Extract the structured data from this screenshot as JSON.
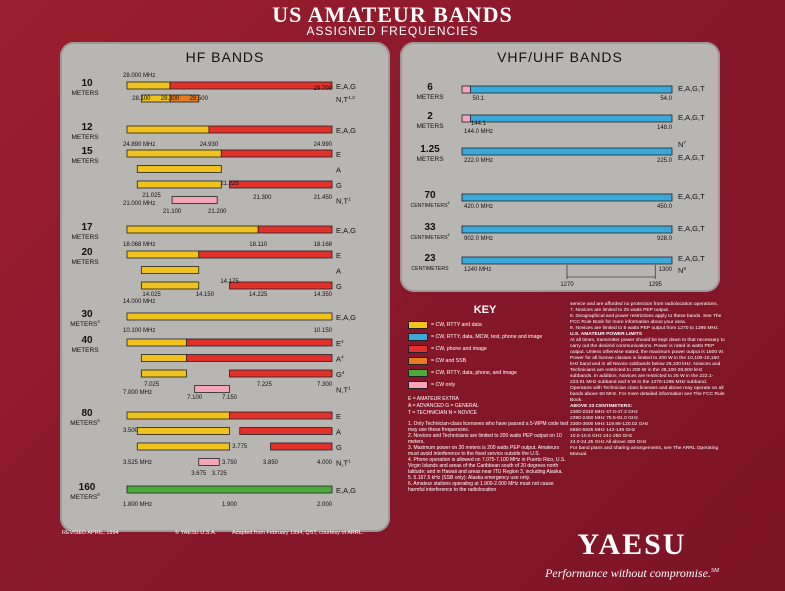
{
  "header": {
    "title": "US AMATEUR BANDS",
    "subtitle": "ASSIGNED FREQUENCIES"
  },
  "colors": {
    "yellow": "#f0c21e",
    "red": "#e2302a",
    "orange": "#e87a1f",
    "pink": "#f4a6b8",
    "blue": "#39a9dc",
    "green": "#4caa38"
  },
  "hf": {
    "title": "HF BANDS",
    "bands": [
      {
        "name": "10",
        "unit": "METERS",
        "mode_labels": [
          {
            "t": "E,A,G",
            "row": 0
          },
          {
            "t": "N,T",
            "sup": "1,2",
            "row": 1
          }
        ],
        "bars": [
          {
            "c": "yellow",
            "x1": 28.0,
            "x2": 28.3,
            "row": 0
          },
          {
            "c": "red",
            "x1": 28.3,
            "x2": 29.7,
            "row": 0
          },
          {
            "c": "yellow",
            "x1": 28.1,
            "x2": 28.3,
            "row": 1
          },
          {
            "c": "orange",
            "x1": 28.3,
            "x2": 28.5,
            "row": 1
          }
        ],
        "freq": [
          {
            "t": "28.000 MHz",
            "row": "top",
            "pos": "start"
          },
          {
            "t": "29.700",
            "row": 0,
            "pos": "end"
          },
          {
            "t": "28.100",
            "row": 1,
            "pos": "b1"
          },
          {
            "t": "28.300",
            "row": 1,
            "pos": "b2"
          },
          {
            "t": "28.500",
            "row": 1,
            "pos": "b3"
          }
        ]
      },
      {
        "name": "12",
        "unit": "METERS",
        "mode_labels": [
          {
            "t": "E,A,G",
            "row": 0
          }
        ],
        "freq": [
          {
            "t": "24.890 MHz"
          },
          {
            "t": "24.930"
          },
          {
            "t": "24.990"
          }
        ]
      },
      {
        "name": "15",
        "unit": "METERS",
        "mode_labels": [
          {
            "t": "E",
            "row": 0
          },
          {
            "t": "A",
            "row": 1
          },
          {
            "t": "G",
            "row": 2
          },
          {
            "t": "N,T",
            "sup": "1",
            "row": 3
          }
        ],
        "freq": [
          {
            "t": "21.025"
          },
          {
            "t": "21.000 MHz"
          },
          {
            "t": "21.225"
          },
          {
            "t": "21.300"
          },
          {
            "t": "21.450"
          },
          {
            "t": "21.100"
          },
          {
            "t": "21.200"
          }
        ]
      },
      {
        "name": "17",
        "unit": "METERS",
        "mode_labels": [
          {
            "t": "E,A,G",
            "row": 0
          }
        ],
        "freq": [
          {
            "t": "18.068 MHz"
          },
          {
            "t": "18.110"
          },
          {
            "t": "18.168"
          }
        ]
      },
      {
        "name": "20",
        "unit": "METERS",
        "mode_labels": [
          {
            "t": "E",
            "row": 0
          },
          {
            "t": "A",
            "row": 1
          },
          {
            "t": "G",
            "row": 2
          }
        ],
        "freq": [
          {
            "t": "14.025"
          },
          {
            "t": "14.000 MHz"
          },
          {
            "t": "14.150"
          },
          {
            "t": "14.175"
          },
          {
            "t": "14.225"
          },
          {
            "t": "14.350"
          }
        ]
      },
      {
        "name": "30",
        "unit": "METERS",
        "unit_sup": "3",
        "mode_labels": [
          {
            "t": "E,A,G",
            "row": 0
          }
        ],
        "freq": [
          {
            "t": "10.100 MHz"
          },
          {
            "t": "10.150"
          }
        ]
      },
      {
        "name": "40",
        "unit": "METERS",
        "mode_labels": [
          {
            "t": "E",
            "sup": "4",
            "row": 0
          },
          {
            "t": "A",
            "sup": "4",
            "row": 1
          },
          {
            "t": "G",
            "sup": "4",
            "row": 2
          },
          {
            "t": "N,T",
            "sup": "1",
            "row": 3
          }
        ],
        "freq": [
          {
            "t": "7.025"
          },
          {
            "t": "7.000 MHz"
          },
          {
            "t": "7.100"
          },
          {
            "t": "7.150"
          },
          {
            "t": "7.225"
          },
          {
            "t": "7.300"
          }
        ]
      },
      {
        "name": "80",
        "unit": "METERS",
        "unit_sup": "5",
        "mode_labels": [
          {
            "t": "E",
            "row": 0
          },
          {
            "t": "A",
            "row": 1
          },
          {
            "t": "G",
            "row": 2
          },
          {
            "t": "N,T",
            "sup": "1",
            "row": 3
          }
        ],
        "freq": [
          {
            "t": "3.500"
          },
          {
            "t": "3.525 MHz"
          },
          {
            "t": "3.675"
          },
          {
            "t": "3.725"
          },
          {
            "t": "3.750"
          },
          {
            "t": "3.775"
          },
          {
            "t": "3.850"
          },
          {
            "t": "4.000"
          }
        ]
      },
      {
        "name": "160",
        "unit": "METERS",
        "unit_sup": "6",
        "mode_labels": [
          {
            "t": "E,A,G",
            "row": 0
          }
        ],
        "freq": [
          {
            "t": "1.800 MHz"
          },
          {
            "t": "1.900"
          },
          {
            "t": "2.000"
          }
        ]
      }
    ]
  },
  "vhf": {
    "title": "VHF/UHF BANDS",
    "bands": [
      {
        "name": "6",
        "unit": "METERS",
        "mode": "E,A,G,T",
        "freq": [
          "50.0 MHz",
          "50.1",
          "54.0"
        ]
      },
      {
        "name": "2",
        "unit": "METERS",
        "mode": "E,A,G,T",
        "freq": [
          "144.1",
          "144.0 MHz",
          "148.0"
        ]
      },
      {
        "name": "1.25",
        "unit": "METERS",
        "mode": "N",
        "mode_sup": "7",
        "mode2": "E,A,G,T",
        "freq": [
          "222.0 MHz",
          "225.0"
        ]
      },
      {
        "name": "70",
        "unit": "CENTIMETERS",
        "unit_sup": "8",
        "mode": "E,A,G,T",
        "freq": [
          "420.0 MHz",
          "450.0"
        ]
      },
      {
        "name": "33",
        "unit": "CENTIMETERS",
        "unit_sup": "8",
        "mode": "E,A,G,T",
        "freq": [
          "902.0 MHz",
          "928.0"
        ]
      },
      {
        "name": "23",
        "unit": "CENTIMETERS",
        "mode": "E,A,G,T",
        "mode2": "N",
        "mode2_sup": "9",
        "freq": [
          "1240 MHz",
          "1300",
          "1270",
          "1295"
        ]
      }
    ]
  },
  "key": {
    "title": "KEY",
    "items": [
      {
        "color": "yellow",
        "label": "= CW, RTTY and data"
      },
      {
        "color": "blue",
        "label": "= CW, RTTY, data, MCW, test, phone and image"
      },
      {
        "color": "red",
        "label": "= CW, phone and image"
      },
      {
        "color": "orange",
        "label": "= CW and SSB"
      },
      {
        "color": "green",
        "label": "= CW, RTTY, data, phone, and image"
      },
      {
        "color": "pink",
        "label": "= CW only"
      }
    ],
    "legend": [
      "E = AMATEUR EXTRA",
      "A = ADVANCED  G = GENERAL",
      "T = TECHNICIAN  N = NOVICE"
    ],
    "notes": [
      "1.  Only Technician-class licensees who have passed a 5-WPM code test may use these frequencies.",
      "2.  Novices and Technicians are limited to 200 watts PEP output on 10 meters.",
      "3.  Maximum power on 30 meters is 200 watts PEP output. Amateurs must avoid interference to the fixed service outside the U.S.",
      "4.  Phone operation is allowed on 7.075-7.100 MHz in Puerto Rico, U.S. Virgin Islands and areas of the Caribbean south of 20 degrees north latitude; and in Hawaii and areas near ITU Region 3, including Alaska.",
      "5.  5.167.5 kHz (SSB only): Alaska emergency use only.",
      "6.  Amateur stations operating at 1.900-2.000 MHz must not cause harmful interference to the radiolocation"
    ]
  },
  "notes_right": [
    "service and are afforded no protection from radiolocation operations.",
    "7.  Novices are limited to 25 watts PEP output.",
    "8.  Geographical and power restrictions apply to these bands. See The FCC Rule Book for more information about your area.",
    "9.  Novices are limited to 5 watts PEP output from 1270 to 1295 MHz.",
    "U.S. AMATEUR POWER LIMITS",
    "At all times, transmitter power should be kept down to that necessary to carry out the desired communications. Power is rated in watts PEP output. Unless otherwise stated, the maximum power output is 1500 W. Power for all license classes is limited to 200 W in the 10,100-10,150 kHz band and in all Novice subbands below 28,100 kHz. Novices and Technicians are restricted to 200 W in the 28,100-28,500 kHz subbands. In addition, Novices are restricted to 25 W in the 222.1-223.91 MHz subband and 5 W in the 1270-1295 MHz subband.",
    "Operators with Technician class licenses and above may operate on all bands above 50 MHz. For more detailed information see The FCC Rule Book.",
    "ABOVE 23 CENTIMETERS:",
    "2300-2310 MHz        47.0-47.2 GHz",
    "2390-2450 MHz        75.5-81.0 GHz",
    "3300-3500 MHz        119.98-120.02 GHz",
    "5650-5925 MHz        142-149 GHz",
    "10.0-10.5 GHz        241-250 GHz",
    "24.0-24.25 GHz       All above 300 GHz",
    "For band plans and sharing arrangements, see The ARRL Operating Manual."
  ],
  "footer": {
    "revised": "REVISED APRIL, 1994",
    "copyright": "© YAESU U.S.A.",
    "adapted": "Adapted from February 1994, QST, courtesy of ARRL."
  },
  "brand": {
    "name": "YAESU",
    "slogan": "Performance without compromise.",
    "slogan_sup": "SM"
  }
}
